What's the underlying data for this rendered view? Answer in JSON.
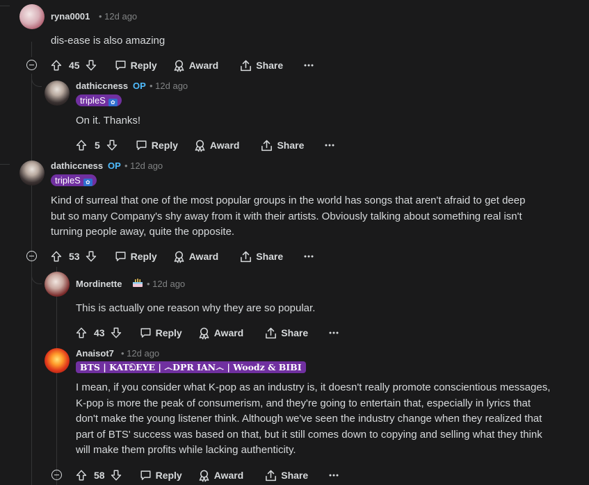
{
  "comments": [
    {
      "username": "ryna0001",
      "time": "12d ago",
      "body": [
        "dis-ease is also amazing"
      ],
      "votes": "45",
      "reply_label": "Reply",
      "award_label": "Award",
      "share_label": "Share"
    },
    {
      "username": "dathiccness",
      "op_badge": "OP",
      "time": "12d ago",
      "flair": "tripleS",
      "body": [
        "On it. Thanks!"
      ],
      "votes": "5",
      "reply_label": "Reply",
      "award_label": "Award",
      "share_label": "Share"
    },
    {
      "username": "dathiccness",
      "op_badge": "OP",
      "time": "12d ago",
      "flair": "tripleS",
      "body": [
        "Kind of surreal that one of the most popular groups in the world has songs that aren't afraid to get deep",
        "but so many Company's shy away from it with their artists. Obviously talking about something real isn't",
        "turning people away, quite the opposite."
      ],
      "votes": "53",
      "reply_label": "Reply",
      "award_label": "Award",
      "share_label": "Share"
    },
    {
      "username": "Mordinette",
      "time": "12d ago",
      "body": [
        "This is actually one reason why they are so popular."
      ],
      "votes": "43",
      "reply_label": "Reply",
      "award_label": "Award",
      "share_label": "Share"
    },
    {
      "username": "Anaisot7",
      "time": "12d ago",
      "flair": "BTS | KATඞEYE | ෴DPR IAN෴ | Woodz & BIBI",
      "body": [
        "I mean, if you consider what K-pop as an industry is, it doesn't really promote conscientious messages,",
        "K-pop is more the peak of consumerism, and they're going to entertain that, especially in lyrics that",
        "don't make the young listener think. Although we've seen the industry change when they realized that",
        "part of BTS' success was based on that, but it still comes down to copying and selling what they think",
        "will make them profits while lacking authenticity."
      ],
      "votes": "58",
      "reply_label": "Reply",
      "award_label": "Award",
      "share_label": "Share"
    }
  ],
  "colors": {
    "background": "#1a1a1b",
    "text": "#d7dadc",
    "muted": "#818384",
    "op_blue": "#4fbcff",
    "flair_purple": "#7030a0",
    "thread_line": "#343536"
  },
  "icons": {
    "upvote": "arrow-up-icon",
    "downvote": "arrow-down-icon",
    "reply": "speech-bubble-icon",
    "award": "award-ribbon-icon",
    "share": "share-upload-icon",
    "more": "ellipsis-icon",
    "collapse": "minus-circle-icon"
  }
}
